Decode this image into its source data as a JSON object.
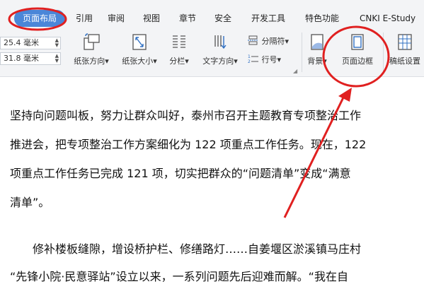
{
  "tabs": [
    "页面布局",
    "引用",
    "审阅",
    "视图",
    "章节",
    "安全",
    "开发工具",
    "特色功能",
    "CNKI E-Study"
  ],
  "margins": {
    "top_value": "25.4 毫米",
    "bottom_value": "31.8 毫米"
  },
  "tools": {
    "orientation": "纸张方向",
    "paper_size": "纸张大小",
    "columns": "分栏",
    "text_direction": "文字方向",
    "separator": "分隔符",
    "line_number": "行号",
    "background": "背景",
    "page_border": "页面边框",
    "paper_setup": "稿纸设置"
  },
  "document": {
    "p1_l1": "坚持向问题叫板，努力让群众叫好，泰州市召开主题教育专项整治工作",
    "p1_l2": "推进会，把专项整治工作方案细化为 122 项重点工作任务。现在，122",
    "p1_l3": "项重点工作任务已完成 121 项，切实把群众的“问题清单”变成“满意",
    "p1_l4": "清单”。",
    "p2_l1": "修补楼板缝隙，增设桥护栏、修缮路灯……自姜堰区淤溪镇马庄村",
    "p2_l2": "“先锋小院·民意驿站”设立以来，一系列问题先后迎难而解。“我在自"
  },
  "colors": {
    "accent": "#4a86d8",
    "annotation": "#e02020",
    "icon_blue": "#2f6fc2"
  }
}
